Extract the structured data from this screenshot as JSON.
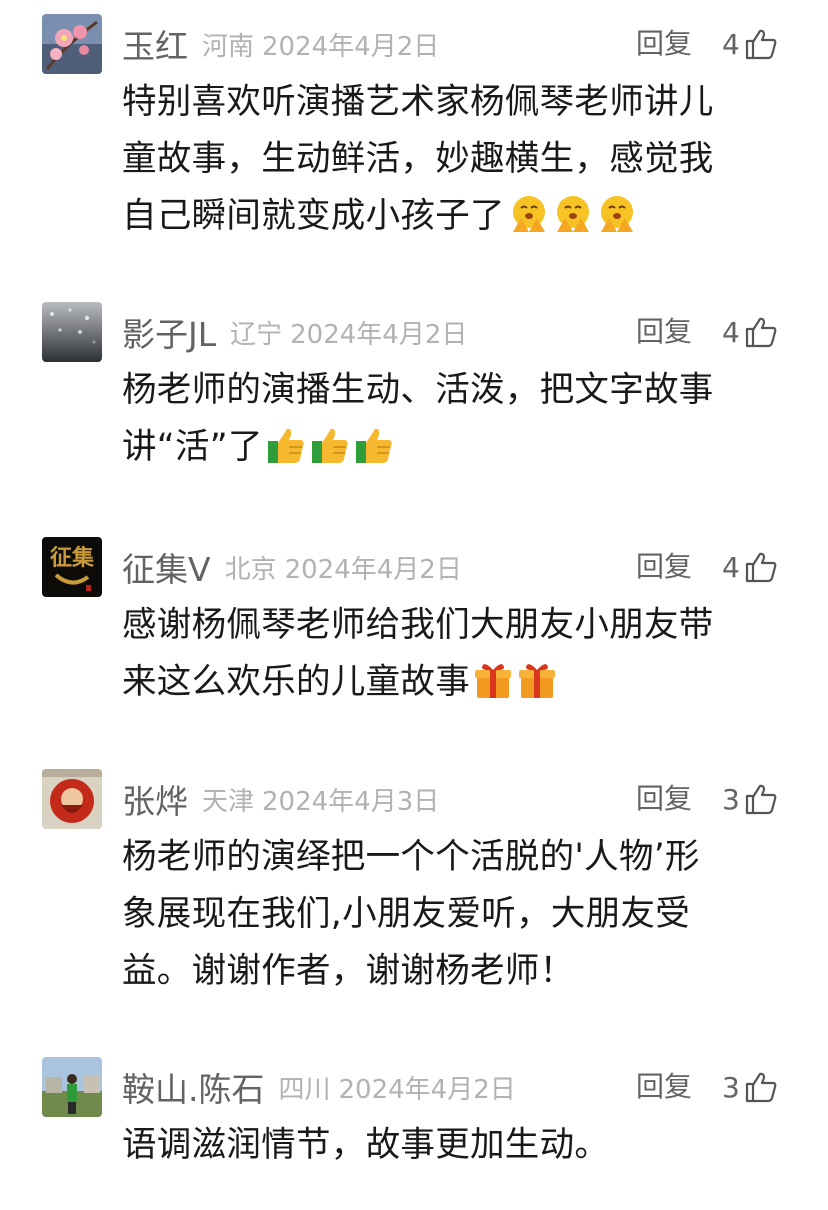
{
  "comments": [
    {
      "nickname": "玉红",
      "location": "河南",
      "date": "2024年4月2日",
      "reply_label": "回复",
      "likes": "4",
      "lines": [
        "特别喜欢听演播艺术家杨佩琴老师讲儿",
        "童故事，生动鲜活，妙趣横生，感觉我",
        "自己瞬间就变成小孩子了"
      ],
      "emoji": "pray-face-emoji",
      "emoji_count": 3
    },
    {
      "nickname": "影子JL",
      "location": "辽宁",
      "date": "2024年4月2日",
      "reply_label": "回复",
      "likes": "4",
      "lines": [
        "杨老师的演播生动、活泼，把文字故事",
        "讲“活”了"
      ],
      "emoji": "thumbs-up-emoji",
      "emoji_count": 3
    },
    {
      "nickname": "征集V",
      "location": "北京",
      "date": "2024年4月2日",
      "reply_label": "回复",
      "likes": "4",
      "lines": [
        "感谢杨佩琴老师给我们大朋友小朋友带",
        "来这么欢乐的儿童故事"
      ],
      "emoji": "gift-emoji",
      "emoji_count": 2,
      "avatar_text": "征集"
    },
    {
      "nickname": "张烨",
      "location": "天津",
      "date": "2024年4月3日",
      "reply_label": "回复",
      "likes": "3",
      "lines": [
        "杨老师的演绎把一个个活脱的'人物’形",
        "象展现在我们,小朋友爱听，大朋友受",
        "益。谢谢作者，谢谢杨老师！"
      ]
    },
    {
      "nickname": "鞍山.陈石",
      "location": "四川",
      "date": "2024年4月2日",
      "reply_label": "回复",
      "likes": "3",
      "lines": [
        "语调滋润情节，故事更加生动。"
      ]
    }
  ],
  "colors": {
    "nickname": "#636363",
    "meta": "#b2b2b2",
    "text": "#191919"
  }
}
